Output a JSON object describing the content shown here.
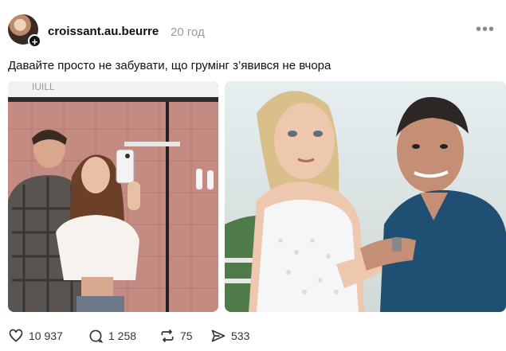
{
  "post": {
    "username": "croissant.au.beurre",
    "timestamp": "20 год",
    "more_label": "•••",
    "text": "Давайте просто не забувати, що грумінг з’явився не вчора",
    "photo1_sign": "IUILL"
  },
  "actions": {
    "likes": "10 937",
    "comments": "1 258",
    "reposts": "75",
    "shares": "533"
  }
}
